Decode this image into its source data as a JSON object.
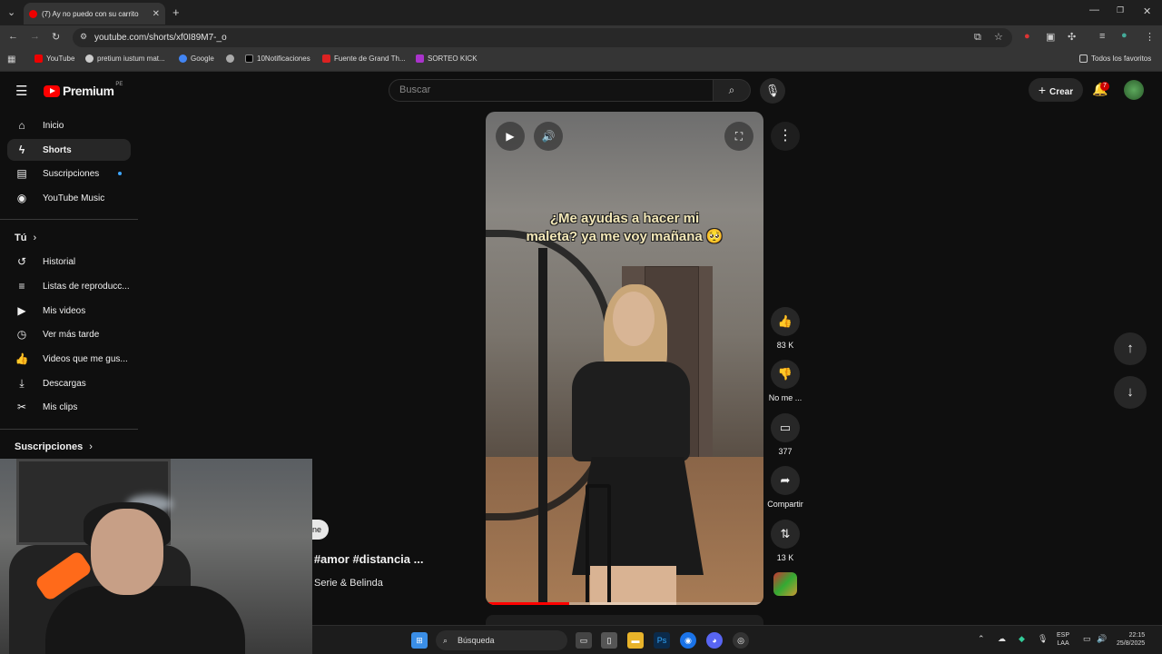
{
  "browser": {
    "tab_title": "(7) Ay no puedo con su carrito",
    "tab_close": "✕",
    "new_tab": "+",
    "url": "youtube.com/shorts/xf0I89M7-_o",
    "bookmarks": [
      "YouTube",
      "pretium iustum mat...",
      "Google",
      "10Notificaciones",
      "Fuente de Grand Th...",
      "SORTEO KICK"
    ],
    "all_bookmarks": "Todos los favoritos",
    "colors": {
      "chrome_dark": "#1f1f1f",
      "chrome_mid": "#353535",
      "accent_red": "#ff0000"
    }
  },
  "youtube": {
    "logo_text": "Premium",
    "logo_region": "PE",
    "search_placeholder": "Buscar",
    "create_label": "Crear",
    "notification_count": "7",
    "sidebar": {
      "main": [
        {
          "label": "Inicio",
          "icon": "home-icon"
        },
        {
          "label": "Shorts",
          "icon": "shorts-icon"
        },
        {
          "label": "Suscripciones",
          "icon": "subscriptions-icon"
        },
        {
          "label": "YouTube Music",
          "icon": "music-icon"
        }
      ],
      "you_heading": "Tú",
      "you": [
        {
          "label": "Historial",
          "icon": "history-icon"
        },
        {
          "label": "Listas de reproducc...",
          "icon": "playlist-icon"
        },
        {
          "label": "Mis videos",
          "icon": "my-videos-icon"
        },
        {
          "label": "Ver más tarde",
          "icon": "clock-icon"
        },
        {
          "label": "Videos que me gus...",
          "icon": "thumbs-up-icon"
        },
        {
          "label": "Descargas",
          "icon": "download-icon"
        },
        {
          "label": "Mis clips",
          "icon": "scissors-icon"
        }
      ],
      "subs_heading": "Suscripciones"
    },
    "short": {
      "caption_line1": "¿Me ayudas a hacer mi",
      "caption_line2": "maleta? ya me voy mañana 🥺",
      "progress": 0.3,
      "title": "#amor #distancia ...",
      "channel": "Serie & Belinda",
      "chip": "ne"
    },
    "actions": {
      "likes": "83 K",
      "dislike": "No me ...",
      "comments": "377",
      "share": "Compartir",
      "remix": "13 K"
    }
  },
  "taskbar": {
    "search": "Búsqueda",
    "lang1": "ESP",
    "lang2": "LAA",
    "time": "22:15",
    "date": "25/8/2025"
  }
}
